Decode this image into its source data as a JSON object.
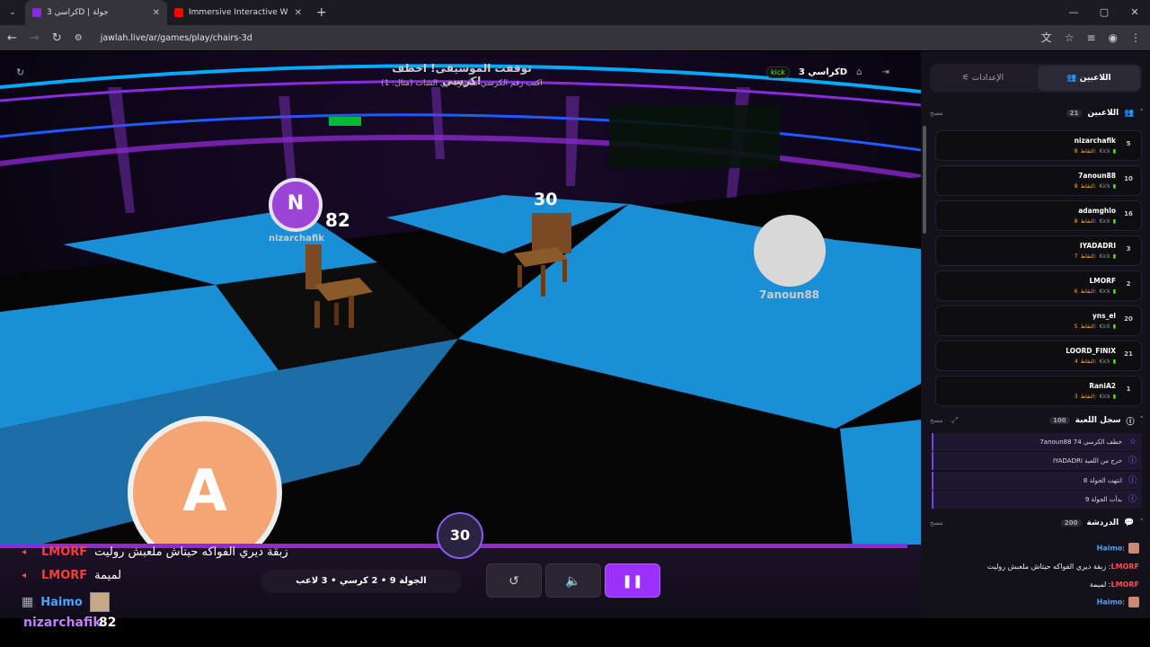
{
  "browser": {
    "tabs": [
      {
        "title": "كراسي 3D | جولة",
        "active": true
      },
      {
        "title": "Immersive Interactive Warm Up",
        "active": false
      }
    ],
    "new_tab": "+",
    "url": "jawlah.live/ar/games/play/chairs-3d"
  },
  "game": {
    "title": "كراسي 3D",
    "kick_label": "kick",
    "hud_title": "توقفت الموسيقى! اخطف كرسي!",
    "hud_sub": "اكتب رقم الكرسي مباشرة في الشات (مثال: 1)",
    "scene_players": [
      {
        "initial": "N",
        "name": "nizarchafik",
        "color": "#9b44d6"
      },
      {
        "initial": "",
        "name": "7anoun88",
        "color": "#d8d8d8"
      },
      {
        "initial": "A",
        "name": "",
        "color": "#f4a572"
      }
    ],
    "chair_numbers": [
      "82",
      "30"
    ],
    "timer": "30",
    "round_info": "الجولة 9 • 2 كرسي • 3 لاعب",
    "chat": [
      {
        "user": "LMORF",
        "msg": "زبقة ديري الفواكه حيتاش ملعبش روليت",
        "color": "#ff3b3b"
      },
      {
        "user": "LMORF",
        "msg": "لميمة",
        "color": "#ff3b3b"
      },
      {
        "user": "Haimo",
        "msg": "",
        "color": "#4da3ff"
      }
    ],
    "bottom_user": {
      "name": "nizarchafik",
      "score": "82"
    }
  },
  "panel": {
    "tabs": [
      "اللاعبين",
      "الإعدادات"
    ],
    "players_header": "اللاعبين",
    "players_count": "21",
    "clear_label": "مسح",
    "points_label": "النقاط:",
    "kick_label": "Kick",
    "players": [
      {
        "name": "nizarchafik",
        "points": "8",
        "rank": "5"
      },
      {
        "name": "7anoun88",
        "points": "8",
        "rank": "10"
      },
      {
        "name": "adamghlo",
        "points": "8",
        "rank": "16"
      },
      {
        "name": "IYADADRI",
        "points": "7",
        "rank": "3"
      },
      {
        "name": "LMORF",
        "points": "6",
        "rank": "2"
      },
      {
        "name": "yns_el",
        "points": "5",
        "rank": "20"
      },
      {
        "name": "LOORD_FINIX",
        "points": "4",
        "rank": "21"
      },
      {
        "name": "RaniA2",
        "points": "3",
        "rank": "1"
      }
    ],
    "log_header": "سجل اللعبة",
    "log_count": "100",
    "log": [
      "7anoun88 خطف الكرسي 74",
      "IYADADRI خرج من اللعبة",
      "انتهت الجولة 8",
      "بدأت الجولة 9"
    ],
    "chat_header": "الدردشة",
    "chat_count": "200",
    "chat": [
      {
        "user": "Haimo",
        "msg": ""
      },
      {
        "user": "LMORF",
        "msg": "زبقة ديري الفواكه حيتاش ملعبش روليت"
      },
      {
        "user": "LMORF",
        "msg": "لميمة"
      },
      {
        "user": "Haimo",
        "msg": ""
      }
    ]
  }
}
